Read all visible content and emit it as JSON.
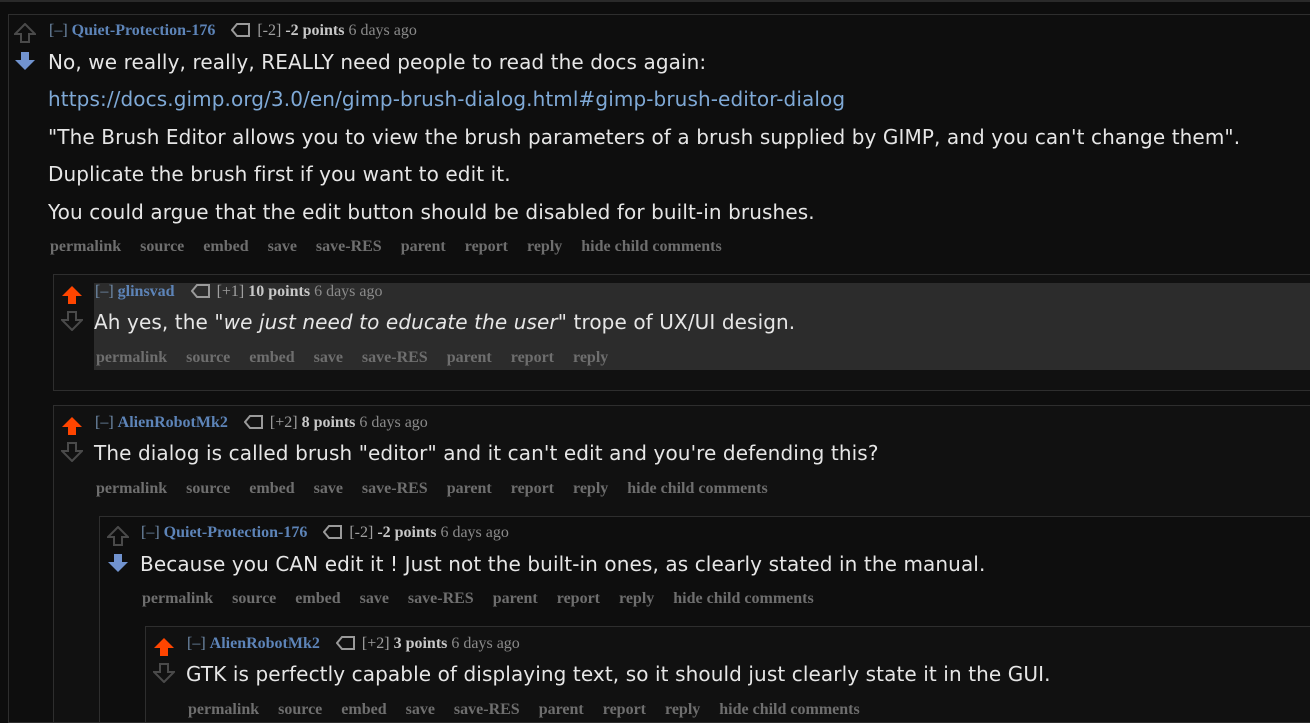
{
  "comments": [
    {
      "collapse": "[–]",
      "author": "Quiet-Protection-176",
      "score_delta": "[-2]",
      "points": "-2 points",
      "time": "6 days ago",
      "lines": [
        "No, we really, really, REALLY need people to read the docs again:",
        "https://docs.gimp.org/3.0/en/gimp-brush-dialog.html#gimp-brush-editor-dialog",
        "\"The Brush Editor allows you to view the brush parameters of a brush supplied by GIMP, and you can't change them\".",
        "Duplicate the brush first if you want to edit it.",
        "You could argue that the edit button should be disabled for built-in brushes."
      ],
      "buttons": [
        "permalink",
        "source",
        "embed",
        "save",
        "save-RES",
        "parent",
        "report",
        "reply",
        "hide child comments"
      ]
    },
    {
      "collapse": "[–]",
      "author": "glinsvad",
      "score_delta": "[+1]",
      "points": "10 points",
      "time": "6 days ago",
      "line_prefix": "Ah yes, the ",
      "line_em": "\"we just need to educate the user\"",
      "line_suffix": " trope of UX/UI design.",
      "buttons": [
        "permalink",
        "source",
        "embed",
        "save",
        "save-RES",
        "parent",
        "report",
        "reply"
      ]
    },
    {
      "collapse": "[–]",
      "author": "AlienRobotMk2",
      "score_delta": "[+2]",
      "points": "8 points",
      "time": "6 days ago",
      "lines": [
        "The dialog is called brush \"editor\" and it can't edit and you're defending this?"
      ],
      "buttons": [
        "permalink",
        "source",
        "embed",
        "save",
        "save-RES",
        "parent",
        "report",
        "reply",
        "hide child comments"
      ]
    },
    {
      "collapse": "[–]",
      "author": "Quiet-Protection-176",
      "score_delta": "[-2]",
      "points": "-2 points",
      "time": "6 days ago",
      "lines": [
        "Because you CAN edit it ! Just not the built-in ones, as clearly stated in the manual."
      ],
      "buttons": [
        "permalink",
        "source",
        "embed",
        "save",
        "save-RES",
        "parent",
        "report",
        "reply",
        "hide child comments"
      ]
    },
    {
      "collapse": "[–]",
      "author": "AlienRobotMk2",
      "score_delta": "[+2]",
      "points": "3 points",
      "time": "6 days ago",
      "lines": [
        "GTK is perfectly capable of displaying text, so it should just clearly state it in the GUI."
      ],
      "buttons": [
        "permalink",
        "source",
        "embed",
        "save",
        "save-RES",
        "parent",
        "report",
        "reply",
        "hide child comments"
      ]
    }
  ],
  "colors": {
    "upvoted": "#ff4500",
    "downvoted": "#7193cf",
    "neutral_arrow": "#4a4a4a",
    "author": "#5d84b8",
    "link": "#7fa9d6"
  },
  "icons": {
    "upvote": "upvote-arrow-icon",
    "downvote": "downvote-arrow-icon",
    "tag": "tag-icon"
  }
}
